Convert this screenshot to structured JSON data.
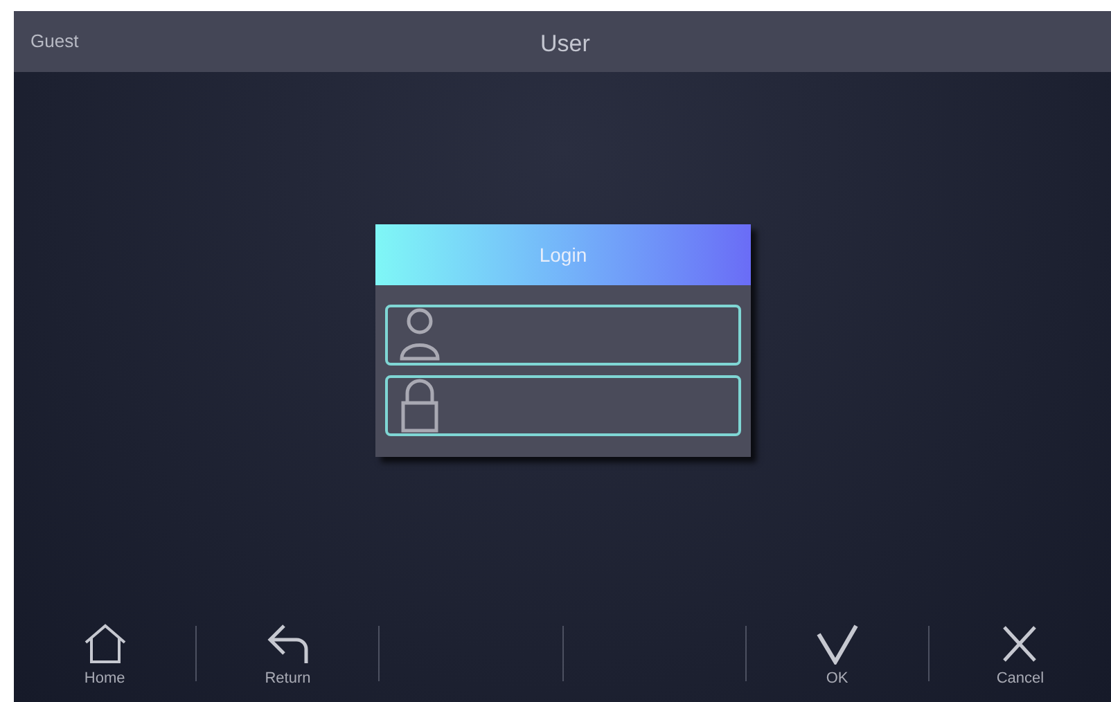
{
  "header": {
    "user": "Guest",
    "title": "User"
  },
  "login": {
    "title": "Login",
    "fields": [
      {
        "kind": "user"
      },
      {
        "kind": "password"
      }
    ]
  },
  "toolbar": [
    {
      "kind": "home",
      "label": "Home"
    },
    {
      "kind": "return",
      "label": "Return"
    },
    {
      "kind": "blank"
    },
    {
      "kind": "blank"
    },
    {
      "kind": "ok",
      "label": "OK"
    },
    {
      "kind": "cancel",
      "label": "Cancel"
    }
  ]
}
